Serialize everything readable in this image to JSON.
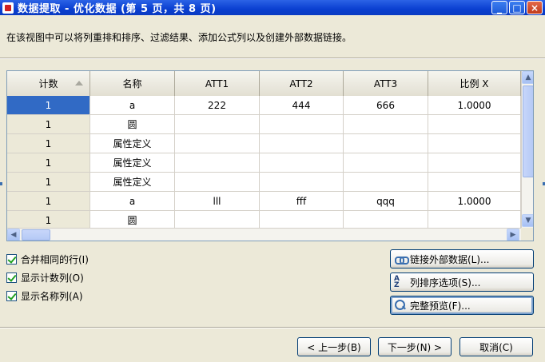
{
  "window": {
    "title": "数据提取 - 优化数据 (第 5 页，共 8 页)",
    "controls": [
      "_",
      "□",
      "×"
    ]
  },
  "description": "在该视图中可以将列重排和排序、过滤结果、添加公式列以及创建外部数据链接。",
  "grid": {
    "columns": [
      "计数",
      "名称",
      "ATT1",
      "ATT2",
      "ATT3",
      "比例 X"
    ],
    "rows": [
      [
        "1",
        "a",
        "222",
        "444",
        "666",
        "1.0000"
      ],
      [
        "1",
        "圆",
        "",
        "",
        "",
        ""
      ],
      [
        "1",
        "属性定义",
        "",
        "",
        "",
        ""
      ],
      [
        "1",
        "属性定义",
        "",
        "",
        "",
        ""
      ],
      [
        "1",
        "属性定义",
        "",
        "",
        "",
        ""
      ],
      [
        "1",
        "a",
        "lll",
        "fff",
        "qqq",
        "1.0000"
      ],
      [
        "1",
        "圆",
        "",
        "",
        "",
        ""
      ]
    ],
    "selected_row": 0,
    "scroll": {
      "up": "▲",
      "down": "▼",
      "left": "◀",
      "right": "▶"
    }
  },
  "options": [
    {
      "label": "合并相同的行(I)",
      "checked": true
    },
    {
      "label": "显示计数列(O)",
      "checked": true
    },
    {
      "label": "显示名称列(A)",
      "checked": true
    }
  ],
  "side_buttons": [
    {
      "label": "链接外部数据(L)...",
      "icon": "link-icon"
    },
    {
      "label": "列排序选项(S)...",
      "icon": "sort-icon",
      "icon_text": [
        "A",
        "Z"
      ]
    },
    {
      "label": "完整预览(F)...",
      "icon": "preview-icon"
    }
  ],
  "nav": {
    "back": "< 上一步(B)",
    "next": "下一步(N) >",
    "cancel": "取消(C)"
  }
}
